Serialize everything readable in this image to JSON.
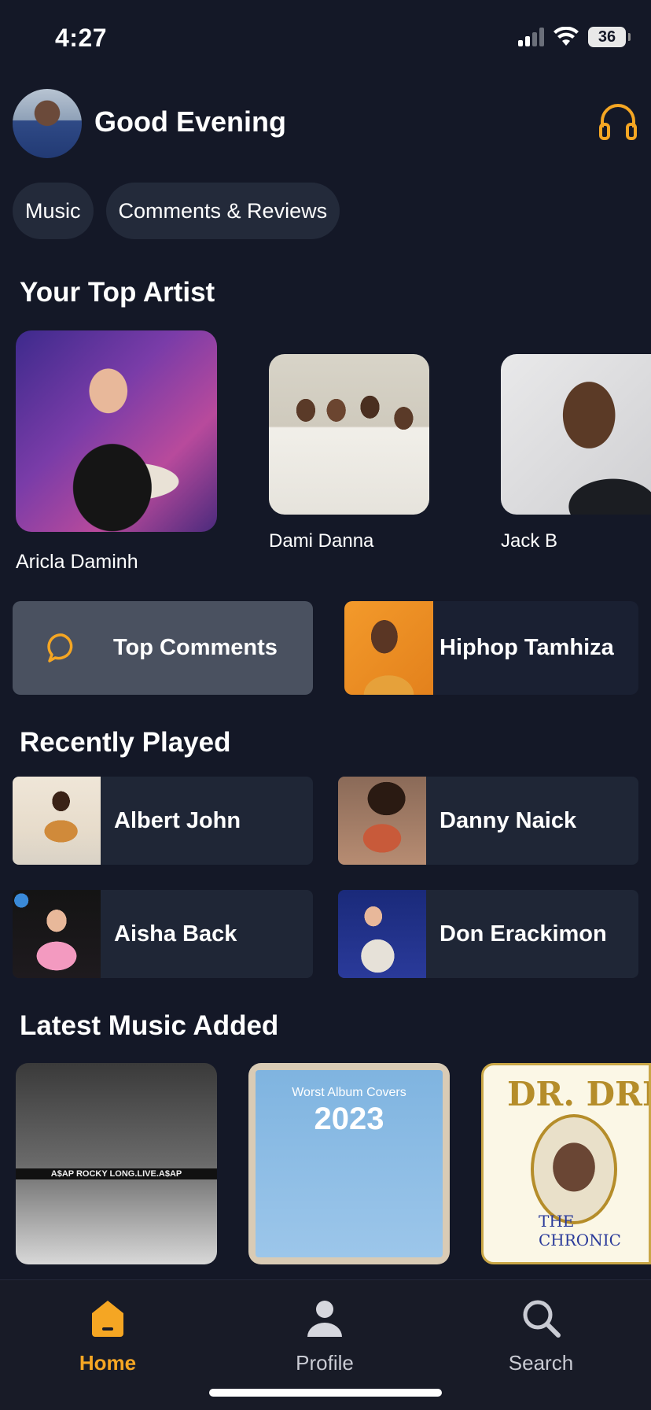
{
  "status_bar": {
    "time": "4:27",
    "battery": "36"
  },
  "header": {
    "greeting": "Good Evening"
  },
  "chips": [
    {
      "label": "Music"
    },
    {
      "label": "Comments & Reviews"
    }
  ],
  "sections": {
    "top_artist": "Your Top Artist",
    "recently_played": "Recently Played",
    "latest_music": "Latest Music Added"
  },
  "top_artists": [
    {
      "name": "Aricla Daminh"
    },
    {
      "name": "Dami Danna"
    },
    {
      "name": "Jack B"
    }
  ],
  "top_cards": {
    "comments": "Top Comments",
    "hiphop": "Hiphop Tamhiza"
  },
  "recently_played": [
    {
      "name": "Albert John"
    },
    {
      "name": "Danny Naick"
    },
    {
      "name": "Aisha Back"
    },
    {
      "name": "Don Erackimon"
    }
  ],
  "latest_music": [
    {
      "cover_text": "A$AP ROCKY    LONG.LIVE.A$AP"
    },
    {
      "cover_text": "Worst Album Covers",
      "cover_year": "2023"
    },
    {
      "cover_text": "DR. DRE",
      "cover_subtitle": "THE CHRONIC"
    }
  ],
  "tabs": [
    {
      "label": "Home",
      "icon": "home-icon",
      "active": true
    },
    {
      "label": "Profile",
      "icon": "profile-icon",
      "active": false
    },
    {
      "label": "Search",
      "icon": "search-icon",
      "active": false
    }
  ],
  "colors": {
    "accent": "#f5a623",
    "background": "#141827",
    "card": "#1f2636"
  }
}
